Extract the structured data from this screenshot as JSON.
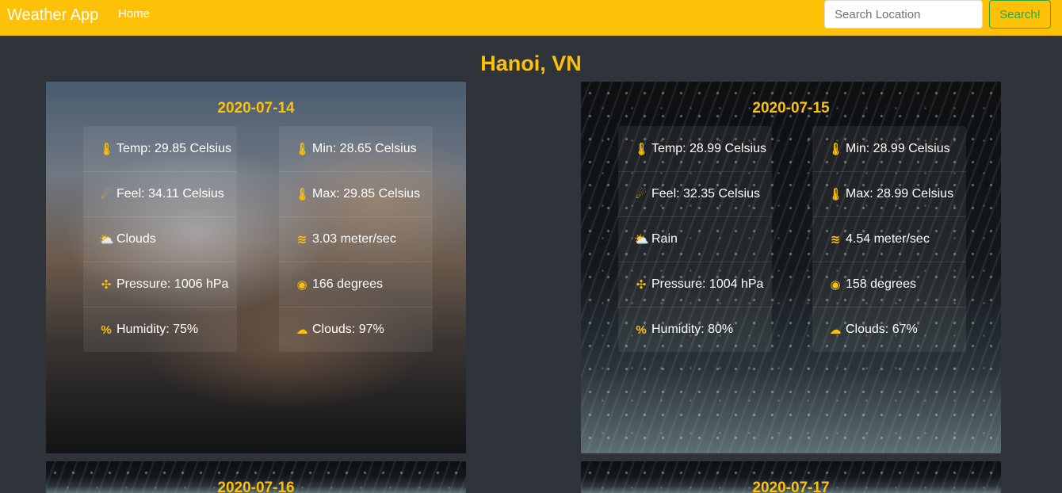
{
  "navbar": {
    "brand": "Weather App",
    "home": "Home",
    "search_placeholder": "Search Location",
    "search_button": "Search!"
  },
  "city": "Hanoi, VN",
  "accent_color": "#fdc107",
  "cards": [
    {
      "date": "2020-07-14",
      "background": "cloudy-sky",
      "left": [
        {
          "icon": "thermometer-icon",
          "text": "Temp: 29.85 Celsius"
        },
        {
          "icon": "feels-like-icon",
          "text": "Feel: 34.11 Celsius"
        },
        {
          "icon": "sun-cloud-icon",
          "text": "Clouds"
        },
        {
          "icon": "pressure-icon",
          "text": "Pressure: 1006 hPa"
        },
        {
          "icon": "percent-icon",
          "text": "Humidity: 75%"
        }
      ],
      "right": [
        {
          "icon": "temperature-min-icon",
          "text": "Min: 28.65 Celsius"
        },
        {
          "icon": "temperature-max-icon",
          "text": "Max: 29.85 Celsius"
        },
        {
          "icon": "wind-icon",
          "text": "3.03 meter/sec"
        },
        {
          "icon": "compass-icon",
          "text": "166 degrees"
        },
        {
          "icon": "cloud-icon",
          "text": "Clouds: 97%"
        }
      ]
    },
    {
      "date": "2020-07-15",
      "background": "rain",
      "left": [
        {
          "icon": "thermometer-icon",
          "text": "Temp: 28.99 Celsius"
        },
        {
          "icon": "feels-like-icon",
          "text": "Feel: 32.35 Celsius"
        },
        {
          "icon": "sun-cloud-icon",
          "text": "Rain"
        },
        {
          "icon": "pressure-icon",
          "text": "Pressure: 1004 hPa"
        },
        {
          "icon": "percent-icon",
          "text": "Humidity: 80%"
        }
      ],
      "right": [
        {
          "icon": "temperature-min-icon",
          "text": "Min: 28.99 Celsius"
        },
        {
          "icon": "temperature-max-icon",
          "text": "Max: 28.99 Celsius"
        },
        {
          "icon": "wind-icon",
          "text": "4.54 meter/sec"
        },
        {
          "icon": "compass-icon",
          "text": "158 degrees"
        },
        {
          "icon": "cloud-icon",
          "text": "Clouds: 67%"
        }
      ]
    },
    {
      "date": "2020-07-16",
      "background": "rain"
    },
    {
      "date": "2020-07-17",
      "background": "rain"
    }
  ]
}
